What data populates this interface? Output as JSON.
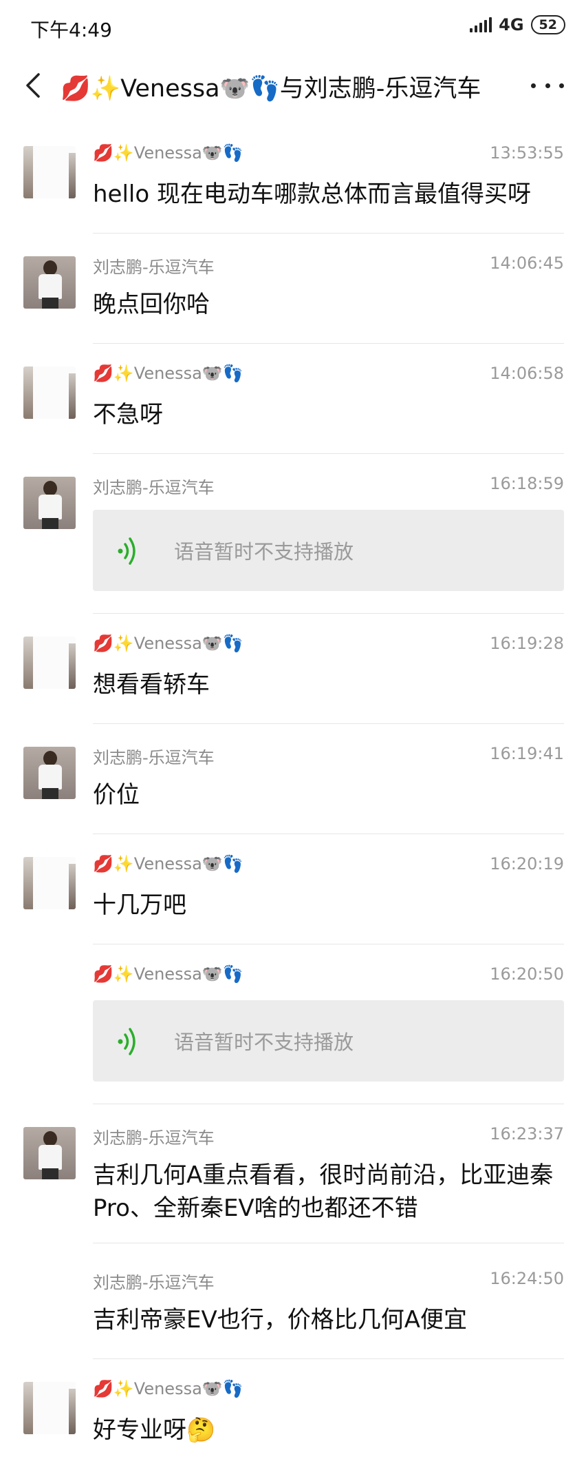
{
  "status": {
    "time": "下午4:49",
    "network": "4G",
    "battery": "52"
  },
  "header": {
    "title": "💋✨Venessa🐨👣与刘志鹏-乐逗汽车"
  },
  "messages": [
    {
      "sender": "💋✨Venessa🐨👣",
      "time": "13:53:55",
      "text": "hello 现在电动车哪款总体而言最值得买呀"
    },
    {
      "sender": "刘志鹏-乐逗汽车",
      "time": "14:06:45",
      "text": "晚点回你哈"
    },
    {
      "sender": "💋✨Venessa🐨👣",
      "time": "14:06:58",
      "text": "不急呀"
    },
    {
      "sender": "刘志鹏-乐逗汽车",
      "time": "16:18:59",
      "voice": "语音暂时不支持播放"
    },
    {
      "sender": "💋✨Venessa🐨👣",
      "time": "16:19:28",
      "text": "想看看轿车"
    },
    {
      "sender": "刘志鹏-乐逗汽车",
      "time": "16:19:41",
      "text": "价位"
    },
    {
      "sender": "💋✨Venessa🐨👣",
      "time": "16:20:19",
      "text": "十几万吧"
    },
    {
      "sender": "💋✨Venessa🐨👣",
      "time": "16:20:50",
      "voice": "语音暂时不支持播放"
    },
    {
      "sender": "刘志鹏-乐逗汽车",
      "time": "16:23:37",
      "text": "吉利几何A重点看看，很时尚前沿，比亚迪秦Pro、全新秦EV啥的也都还不错"
    },
    {
      "sender": "刘志鹏-乐逗汽车",
      "time": "16:24:50",
      "text": "吉利帝豪EV也行，价格比几何A便宜"
    },
    {
      "sender": "💋✨Venessa🐨👣",
      "time": "",
      "text": "好专业呀🤔"
    }
  ]
}
